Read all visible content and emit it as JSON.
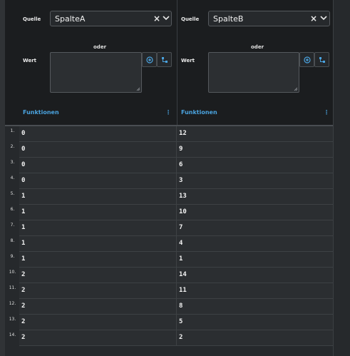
{
  "columns": [
    {
      "quelle_label": "Quelle",
      "source": "SpalteA",
      "oder_label": "oder",
      "wert_label": "Wert",
      "funktionen_label": "Funktionen"
    },
    {
      "quelle_label": "Quelle",
      "source": "SpalteB",
      "oder_label": "oder",
      "wert_label": "Wert",
      "funktionen_label": "Funktionen"
    }
  ],
  "icons": {
    "clear": "×",
    "kebab": "⋮",
    "chevron_right": "›"
  },
  "rows": [
    {
      "n": "1.",
      "a": "0",
      "b": "12"
    },
    {
      "n": "2.",
      "a": "0",
      "b": "9"
    },
    {
      "n": "3.",
      "a": "0",
      "b": "6"
    },
    {
      "n": "4.",
      "a": "0",
      "b": "3"
    },
    {
      "n": "5.",
      "a": "1",
      "b": "13"
    },
    {
      "n": "6.",
      "a": "1",
      "b": "10"
    },
    {
      "n": "7.",
      "a": "1",
      "b": "7"
    },
    {
      "n": "8.",
      "a": "1",
      "b": "4"
    },
    {
      "n": "9.",
      "a": "1",
      "b": "1"
    },
    {
      "n": "10.",
      "a": "2",
      "b": "14"
    },
    {
      "n": "11.",
      "a": "2",
      "b": "11"
    },
    {
      "n": "12.",
      "a": "2",
      "b": "8"
    },
    {
      "n": "13.",
      "a": "2",
      "b": "5"
    },
    {
      "n": "14.",
      "a": "2",
      "b": "2"
    }
  ],
  "colors": {
    "accent": "#4aa3df",
    "panel": "#1b1d1f",
    "row_bg": "#2b2e31"
  }
}
